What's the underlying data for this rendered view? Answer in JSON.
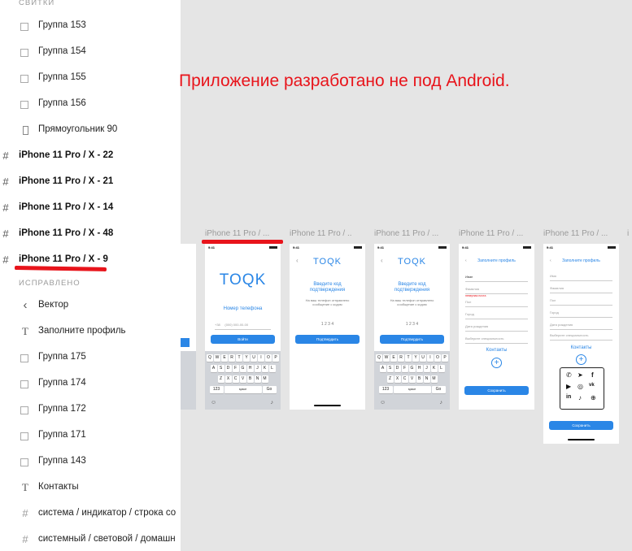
{
  "sidebar": {
    "section_top": "СВИТКИ",
    "section_fixed": "ИСПРАВЛЕНО",
    "items_top": [
      {
        "label": "Группа 153",
        "icon": "group-icon"
      },
      {
        "label": "Группа 154",
        "icon": "group-icon"
      },
      {
        "label": "Группа 155",
        "icon": "group-icon"
      },
      {
        "label": "Группа 156",
        "icon": "group-icon"
      },
      {
        "label": "Прямоугольник 90",
        "icon": "rectangle-icon"
      }
    ],
    "frames": [
      {
        "label": "iPhone 11 Pro / X - 22"
      },
      {
        "label": "iPhone 11 Pro / X - 21"
      },
      {
        "label": "iPhone 11 Pro / X - 14"
      },
      {
        "label": "iPhone 11 Pro / X - 48"
      },
      {
        "label": "iPhone 11 Pro / X - 9"
      }
    ],
    "items_fixed": [
      {
        "label": "Вектор",
        "icon": "vector-icon"
      },
      {
        "label": "Заполните профиль",
        "icon": "text-icon"
      },
      {
        "label": "Группа 175",
        "icon": "group-icon"
      },
      {
        "label": "Группа 174",
        "icon": "group-icon"
      },
      {
        "label": "Группа 172",
        "icon": "group-icon"
      },
      {
        "label": "Группа 171",
        "icon": "group-icon"
      },
      {
        "label": "Группа 143",
        "icon": "group-icon"
      },
      {
        "label": "Контакты",
        "icon": "text-icon"
      },
      {
        "label": "система / индикатор / строка со",
        "icon": "component-icon"
      },
      {
        "label": "системный / световой / домашн",
        "icon": "component-icon"
      }
    ]
  },
  "canvas": {
    "warning": "Приложение разработано не под Android.",
    "frame_label": "iPhone 11 Pro / ...",
    "frame_label_short": "iPhone 11 Pro / ..",
    "frame_label_cut": "i",
    "annotation_color": "#e8141b",
    "accent_color": "#2a86e6",
    "phones": {
      "time": "9:41",
      "logo": "TOQK",
      "phone_label": "Номер телефона",
      "phone_prefix": "+38",
      "phone_placeholder": "(000) 000-00-00",
      "login_button": "Войти",
      "confirm_title": "Введите код подтверждения",
      "confirm_text": "На ваш телефон отправлено сообщение с кодом",
      "code_digits": "1 2 3 4",
      "confirm_button": "Подтвердить",
      "profile_title": "Заполните профиль",
      "fields": [
        "Иван",
        "Фамилия",
        "Пол",
        "Город",
        "Дата рождения",
        "Выберите специальность"
      ],
      "fields_empty": [
        "Имя",
        "Фамилия",
        "Пол",
        "Город",
        "Дата рождения",
        "Выберите специальность"
      ],
      "error_text": "неверная почта",
      "contacts_label": "Контакты",
      "save_button": "Сохранить",
      "keyboard_row1": [
        "Q",
        "W",
        "E",
        "R",
        "T",
        "Y",
        "U",
        "I",
        "O",
        "P"
      ],
      "keyboard_row2": [
        "A",
        "S",
        "D",
        "F",
        "G",
        "H",
        "J",
        "K",
        "L"
      ],
      "keyboard_row3": [
        "Z",
        "X",
        "C",
        "V",
        "B",
        "N",
        "M"
      ],
      "keyboard_num": "123",
      "keyboard_space": "space",
      "keyboard_go": "Go"
    }
  }
}
